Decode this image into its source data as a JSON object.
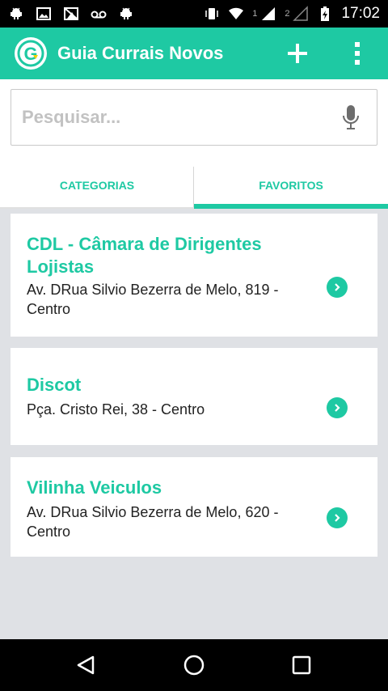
{
  "status_bar": {
    "icons": [
      "android-debug-icon",
      "image-icon",
      "no-signal-icon",
      "voicemail-icon",
      "android-debug-icon"
    ],
    "sim1": "1",
    "sim2": "2",
    "time": "17:02"
  },
  "app_bar": {
    "title": "Guia Currais Novos",
    "logo_letter": "G",
    "accent_color": "#1ec9a3"
  },
  "search": {
    "placeholder": "Pesquisar...",
    "value": ""
  },
  "tabs": [
    {
      "label": "CATEGORIAS",
      "selected": false
    },
    {
      "label": "FAVORITOS",
      "selected": true
    }
  ],
  "favorites": [
    {
      "name": "CDL - Câmara de Dirigentes Lojistas",
      "address": "Av. DRua Silvio Bezerra de Melo, 819 - Centro"
    },
    {
      "name": "Discot",
      "address": "Pça. Cristo Rei, 38 - Centro"
    },
    {
      "name": "Vilinha Veiculos",
      "address": "Av. DRua Silvio Bezerra de Melo, 620 - Centro"
    }
  ]
}
